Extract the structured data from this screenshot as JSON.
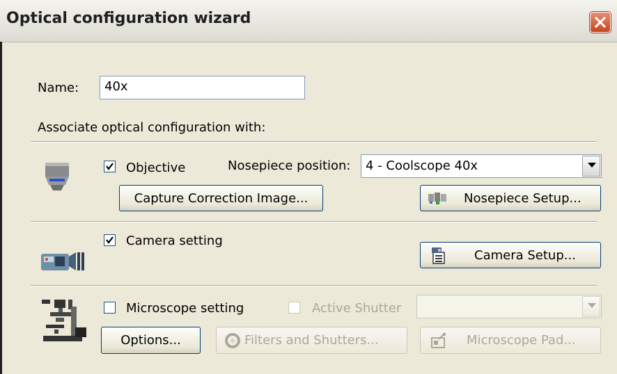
{
  "window": {
    "title": "Optical configuration wizard"
  },
  "name_field": {
    "label": "Name:",
    "value": "40x"
  },
  "associate_label": "Associate optical configuration with:",
  "objective_section": {
    "icon": "objective-icon",
    "checkbox_label": "Objective",
    "checked": true,
    "nosepiece_label": "Nosepiece position:",
    "nosepiece_value": "4 - Coolscope 40x",
    "capture_button": "Capture Correction Image...",
    "nosepiece_setup_button": "Nosepiece Setup...",
    "nosepiece_setup_icon": "nosepiece-icon"
  },
  "camera_section": {
    "icon": "video-camera-icon",
    "checkbox_label": "Camera setting",
    "checked": true,
    "camera_setup_button": "Camera Setup...",
    "camera_setup_icon": "camera-settings-icon"
  },
  "microscope_section": {
    "icon": "microscope-icon",
    "checkbox_label": "Microscope setting",
    "checked": false,
    "active_shutter_label": "Active Shutter",
    "active_shutter_checked": false,
    "active_shutter_enabled": false,
    "shutter_value": "",
    "options_button": "Options...",
    "filters_button": "Filters and Shutters...",
    "filters_icon": "filter-wheel-icon",
    "filters_enabled": false,
    "microscope_pad_button": "Microscope Pad...",
    "microscope_pad_icon": "microscope-pad-icon",
    "microscope_pad_enabled": false
  },
  "colors": {
    "title_bar": "#dcdbd3",
    "close_button": "#c3461f",
    "dialog_bg": "#ece9d8",
    "button_border": "#003c74",
    "disabled_text": "#aca899"
  }
}
